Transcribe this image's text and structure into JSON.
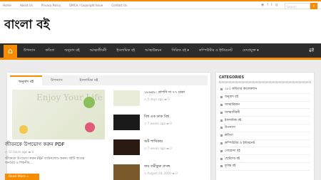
{
  "topbar": {
    "links": [
      "Home",
      "About Us",
      "Privacy Policy",
      "DMCA / Copyright Issue",
      "Contact Us"
    ],
    "social_icons": [
      "rss-icon",
      "facebook-icon",
      "twitter-icon",
      "google-plus-icon"
    ],
    "search_placeholder": "Search"
  },
  "logo": {
    "text": "বাংলা বই"
  },
  "nav": {
    "items": [
      "উপন্যাস",
      "কবিতা",
      "অনুবাদ বই",
      "আত্মজীবনী",
      "ইসলামিক বই",
      "আত্মউন্নয়ন",
      "সিরিজ বই ▾",
      "কম্পিউটার ও ইন্টারনেট",
      "বেদপ্রযুক্ত ▾"
    ]
  },
  "tabs": [
    "অনুবাদ বই",
    "উপন্যাস",
    "ইসলামিক বই"
  ],
  "featured": {
    "image_text": "Enjoy Your Life",
    "title": "জীবনকে উপভোগ করুন PDF",
    "meta_date": "11 hours ago",
    "meta_comments": "0",
    "excerpt": "জীবনকে উপভোগ করুন PDF ডাউনলোড করুন। বইটি অত্যন্ত জনপ্রিয় ও শিক্ষণীয়...",
    "read_more": "Read More »"
  },
  "posts": [
    {
      "title": "১৮৬৫৮: প্রাপণি দা ৭৭ ঢাকা",
      "date": "5 days ago",
      "comments": "0"
    },
    {
      "title": "বিশ্ব এক ডাক বিশ্ব",
      "date": "7 weeks ago",
      "comments": "0"
    },
    {
      "title": "অর্ট পাখিকার",
      "date": "7 weeks ago",
      "comments": "0"
    },
    {
      "title": "জয় তরীকুরু প্রসঙ্গ",
      "date": "August 28, 2020",
      "comments": "0"
    }
  ],
  "sidebar": {
    "heading": "CATEGORIES",
    "items": [
      "১৮০ কবিতার কালেকশান",
      "অনুবাদ বই",
      "আত্মউন্নয়ন",
      "আত্মজীবনী",
      "ইসলামিক বই",
      "উপন্যাস",
      "কবিতা",
      "কম্পিউটার ও ইন্টারনেট",
      "গোয়েন্দা বই",
      "ছোটদের বই",
      "দুর্দান্ত বই"
    ]
  },
  "colors": {
    "accent": "#f88c00",
    "nav_bg": "#2c2c2c"
  }
}
